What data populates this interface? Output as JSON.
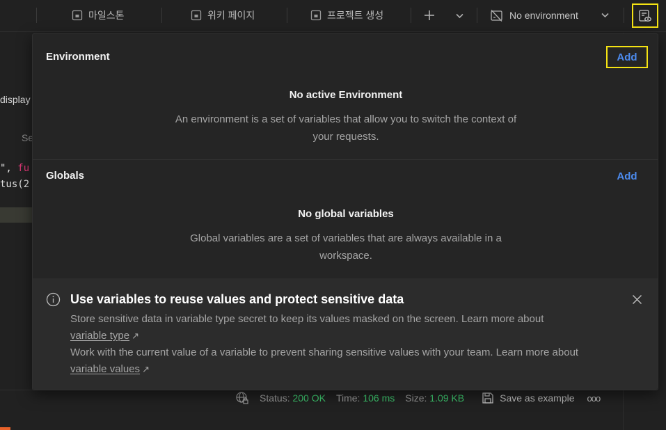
{
  "toolbar": {
    "tabs": [
      {
        "label": "마일스톤",
        "icon": "milestone-icon"
      },
      {
        "label": "위키 페이지",
        "icon": "wiki-page-icon"
      },
      {
        "label": "프로젝트 생성",
        "icon": "create-project-icon"
      }
    ],
    "environment_selector": {
      "label": "No environment"
    }
  },
  "background": {
    "tab_fragment": "display",
    "row_fragment": "Se",
    "code_line_1_str": "\", ",
    "code_line_1_fn": "fu",
    "code_line_2": "tus(2"
  },
  "status_bar": {
    "status_label": "Status:",
    "status_value": "200 OK",
    "time_label": "Time:",
    "time_value": "106 ms",
    "size_label": "Size:",
    "size_value": "1.09 KB",
    "save_example": "Save as example",
    "more": "ooo"
  },
  "popover": {
    "environment": {
      "title": "Environment",
      "add_label": "Add",
      "empty_title": "No active Environment",
      "empty_desc": "An environment is a set of variables that allow you to switch the context of your requests."
    },
    "globals": {
      "title": "Globals",
      "add_label": "Add",
      "empty_title": "No global variables",
      "empty_desc": "Global variables are a set of variables that are always available in a workspace."
    },
    "info_banner": {
      "title": "Use variables to reuse values and protect sensitive data",
      "line1": "Store sensitive data in variable type secret to keep its values masked on the screen. Learn more about",
      "link1": "variable type",
      "line2": "Work with the current value of a variable to prevent sharing sensitive values with your team. Learn more about",
      "link2": "variable values",
      "arrow": "↗"
    }
  },
  "colors": {
    "accent": "#4d8cf0",
    "success": "#3ec96f",
    "highlight": "#f5e313",
    "code_keyword": "#e6397a"
  }
}
